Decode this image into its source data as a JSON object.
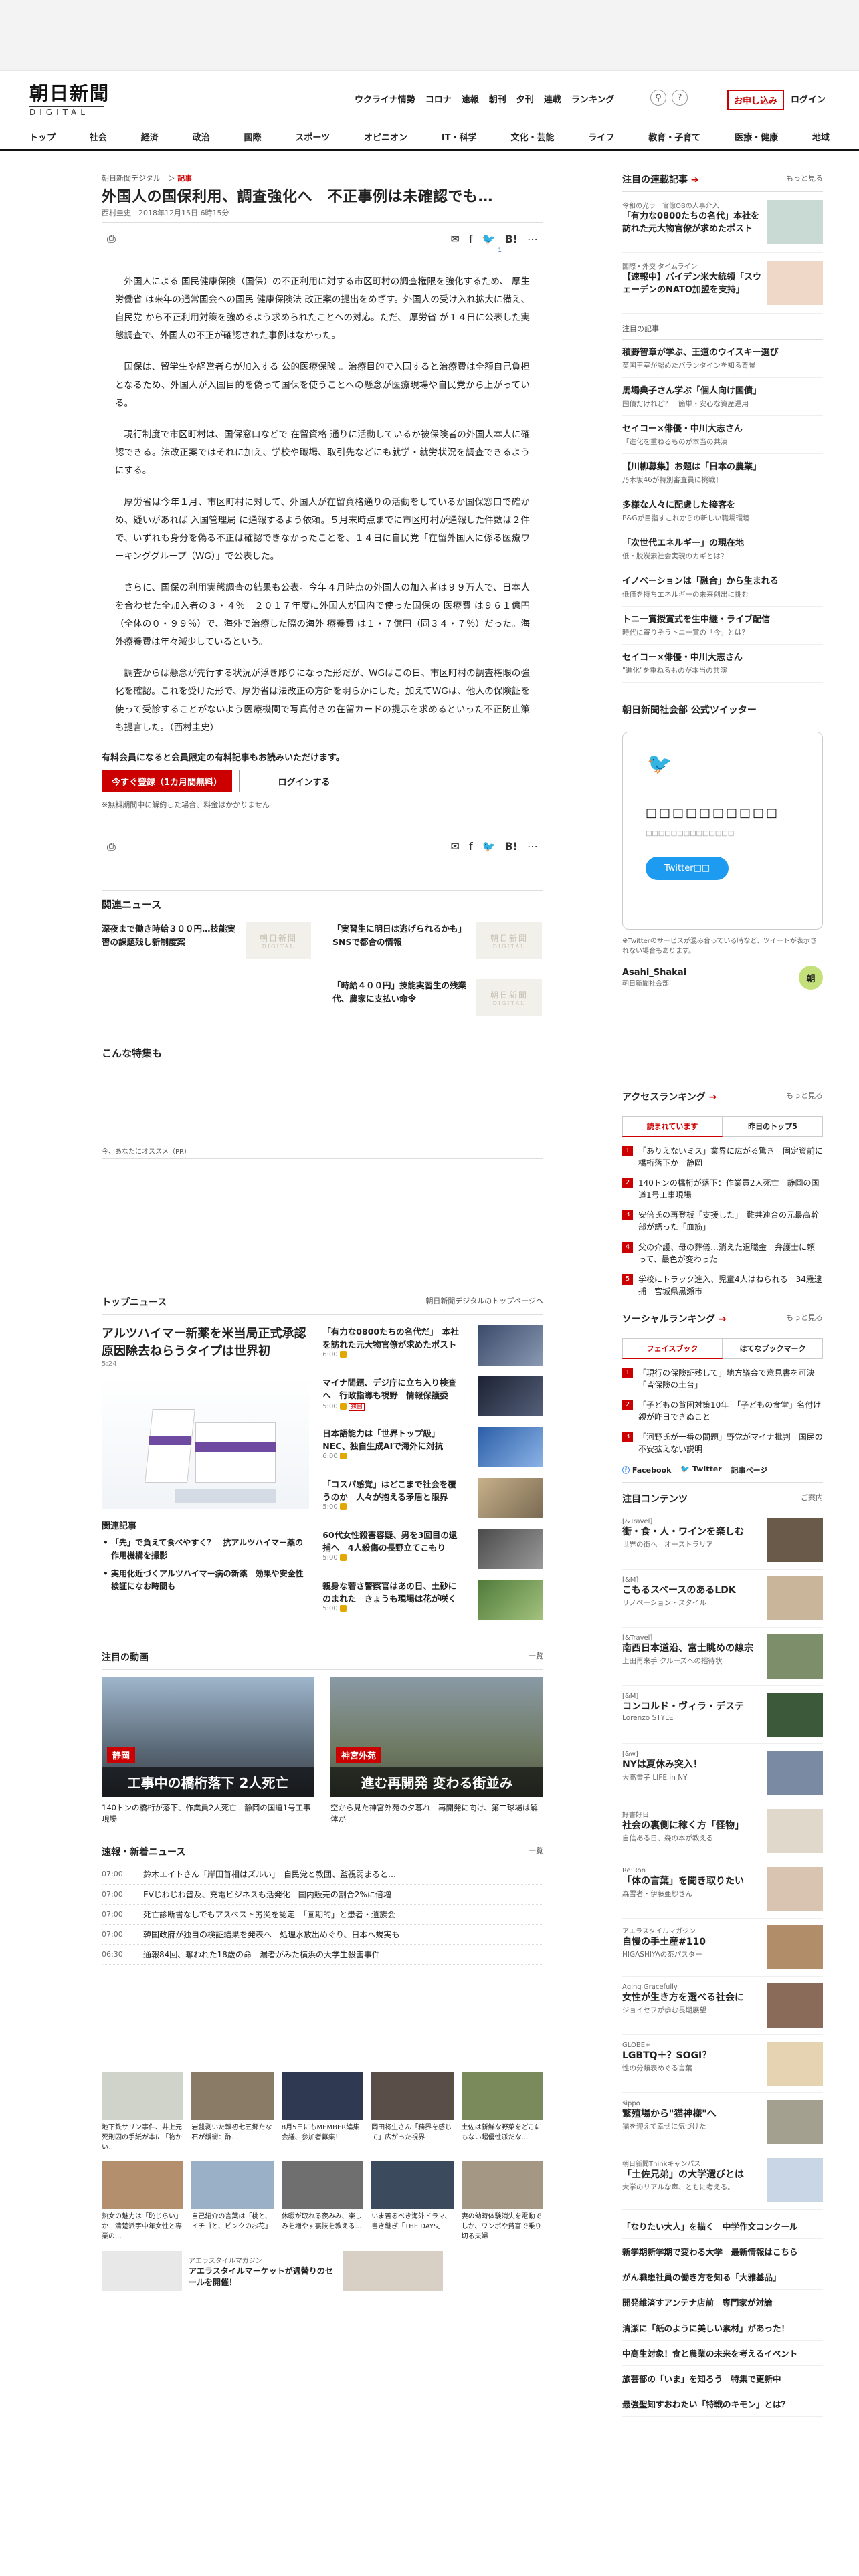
{
  "header": {
    "logo_main": "朝日新聞",
    "logo_sub": "DIGITAL",
    "nav": [
      "ウクライナ情勢",
      "コロナ",
      "速報",
      "朝刊",
      "夕刊",
      "連載",
      "ランキング"
    ],
    "apply_label": "お申し込み",
    "login_label": "ログイン"
  },
  "category_nav": [
    "トップ",
    "社会",
    "経済",
    "政治",
    "国際",
    "スポーツ",
    "オピニオン",
    "IT・科学",
    "文化・芸能",
    "ライフ",
    "教育・子育て",
    "医療・健康",
    "地域"
  ],
  "breadcrumb": {
    "site": "朝日新聞デジタル",
    "section": "記事"
  },
  "article": {
    "title": "外国人の国保利用、調査強化へ　不正事例は未確認でも…",
    "byline": "西村圭史　2018年12月15日 6時15分",
    "share_count": "1",
    "share_link": "list",
    "paragraphs": [
      "外国人による 国民健康保険（国保）の不正利用に対する市区町村の調査権限を強化するため、 厚生労働省 は来年の通常国会への国民 健康保険法 改正案の提出をめざす。外国人の受け入れ拡大に備え、 自民党 から不正利用対策を強めるよう求められたことへの対応。ただ、 厚労省 が１４日に公表した実態調査で、外国人の不正が確認された事例はなかった。",
      "国保は、留学生や経営者らが加入する 公的医療保険 。治療目的で入国すると治療費は全額自己負担となるため、外国人が入国目的を偽って国保を使うことへの懸念が医療現場や自民党から上がっている。",
      "現行制度で市区町村は、国保窓口などで 在留資格 通りに活動しているか被保険者の外国人本人に確認できる。法改正案ではそれに加え、学校や職場、取引先などにも就学・就労状況を調査できるようにする。",
      "厚労省は今年１月、市区町村に対して、外国人が在留資格通りの活動をしているか国保窓口で確かめ、疑いがあれば 入国管理局 に通報するよう依頼。５月末時点までに市区町村が通報した件数は２件で、いずれも身分を偽る不正は確認できなかったことを、１４日に自民党「在留外国人に係る医療ワーキンググループ（WG）」で公表した。",
      "さらに、国保の利用実態調査の結果も公表。今年４月時点の外国人の加入者は９９万人で、日本人を合わせた全加入者の３・４％。２０１７年度に外国人が国内で使った国保の 医療費 は９６１億円（全体の０・９９％）で、海外で治療した際の海外 療養費 は１・７億円（同３４・７％）だった。海外療養費は年々減少しているという。",
      "調査からは懸念が先行する状況が浮き彫りになった形だが、WGはこの日、市区町村の調査権限の強化を確認。これを受けた形で、厚労省は法改正の方針を明らかにした。加えてWGは、他人の保険証を使って受診することがないよう医療機関で写真付きの在留カードの提示を求めるといった不正防止策も提言した。（西村圭史）"
    ],
    "member_title": "有料会員になると会員限定の有料記事もお読みいただけます。",
    "register_label": "今すぐ登録（1カ月間無料）",
    "login_label": "ログインする",
    "member_note": "※無料期間中に解約した場合、料金はかかりません"
  },
  "related": {
    "heading": "関連ニュース",
    "items": [
      "深夜まで働き時給３００円…技能実習の課題残し新制度案",
      "「実習生に明日は逃げられるかも」　SNSで都合の情報",
      "「時給４００円」技能実習生の残業代、農家に支払い命令"
    ]
  },
  "special": {
    "heading": "こんな特集も"
  },
  "pr_label": "今、あなたにオススメ（PR）",
  "top_news": {
    "heading": "トップニュース",
    "more": "朝日新聞デジタルのトップページへ",
    "lead_title": "アルツハイマー新薬を米当局正式承認　原因除去ねらうタイプは世界初",
    "lead_time": "5:24",
    "items": [
      {
        "title": "「有力な0800たちの名代だ」　本社を訪れた元大物官僚が求めたポスト",
        "time": "6:00"
      },
      {
        "title": "マイナ問題、デジ庁に立ち入り検査へ　行政指導も視野　情報保護委",
        "time": "5:00",
        "tag": "独自"
      },
      {
        "title": "日本語能力は「世界トップ級」　NEC、独自生成AIで海外に対抗",
        "time": "6:00"
      },
      {
        "title": "「コスパ感覚」はどこまで社会を覆うのか　人々が抱える矛盾と限界",
        "time": "5:00"
      },
      {
        "title": "60代女性殺害容疑、男を3回目の逮捕へ　4人殺傷の長野立てこもり",
        "time": "5:00"
      },
      {
        "title": "親身な若さ警察官はあの日、土砂に のまれた　きょうも現場は花が咲く",
        "time": "5:00"
      }
    ],
    "related_heading": "関連記事",
    "related": [
      "「先」で負えて食べやすく？　抗アルツハイマー薬の作用機構を撮影",
      "実用化近づくアルツハイマー病の新薬　効果や安全性検証になお時間も"
    ]
  },
  "videos": {
    "heading": "注目の動画",
    "more": "一覧",
    "items": [
      {
        "tag": "静岡",
        "overlay": "工事中の橋桁落下 2人死亡",
        "caption": "140トンの橋桁が落下、作業員2人死亡　静岡の国道1号工事現場"
      },
      {
        "tag": "神宮外苑",
        "overlay": "進む再開発 変わる街並み",
        "caption": "空から見た神宮外苑の夕暮れ　再開発に向け、第二球場は解体が"
      }
    ]
  },
  "breaking": {
    "heading": "速報・新着ニュース",
    "more": "一覧",
    "items": [
      {
        "time": "07:00",
        "text": "鈴木エイトさん「岸田首相はズルい」　自民党と教団、監視弱まると…"
      },
      {
        "time": "07:00",
        "text": "EVじわじわ普及、充電ビジネスも活発化　国内販売の割合2%に倍増"
      },
      {
        "time": "07:00",
        "text": "死亡診断書なしでもアスベスト労災を認定　「画期的」と患者・遺族会"
      },
      {
        "time": "07:00",
        "text": "韓国政府が独自の検証結果を発表へ　処理水放出めぐり、日本へ規実も"
      },
      {
        "time": "06:30",
        "text": "通報84回、奪われた18歳の命　漏者がみた横浜の大学生殺害事件"
      }
    ]
  },
  "bottom_grid": [
    "地下鉄サリン事件、井上元死刑囚の手紙が本に「物かい…",
    "岩盤剥いた報初七五郷たな石が緩衝：酢…",
    "8月5日にもMEMBER編集会議、参加者募集！",
    "岡田将生さん「務界を感じて」広がった視界",
    "土佐は新鮮な野菜をどこにもない超優性派だな…",
    "熟女の魅力は「恥じらい」か　清楚派宇中年女性と専業の…",
    "自己紹介の言葉は「桃と、イチゴと、ピンクのお花」",
    "休暇が取れる夜みみ、楽しみを増やす裏技を教える…",
    "いま苦るべき海外ドラマ、書き継ぎ「THE DAYS」",
    "妻の幼時体験消失を電動でしか、ワンボや貧富で乗り切る夫婦"
  ],
  "ad": {
    "label": "アエラスタイルマガジン",
    "text": "アエラスタイルマーケットが週替りのセールを開催！"
  },
  "sidebar": {
    "series_heading": "注目の連載記事",
    "more": "もっと見る",
    "series": [
      {
        "meta": "令和の光ラ　官僚OBの人事介入",
        "title": "「有力な0800たちの名代」本社を訪れた元大物官僚が求めたポスト"
      },
      {
        "meta": "国際・外交 タイムライン",
        "title": "【速報中】バイデン米大統領「スウェーデンのNATO加盟を支持」"
      }
    ],
    "paid_label": "注目の記事",
    "paid": [
      {
        "title": "積野智章が学ぶ、王道のウイスキー選び",
        "sub": "英国王室が認めたバランタインを知る背景"
      },
      {
        "title": "馬場典子さん学ぶ「個人向け国債」",
        "sub": "国債だけれど？　簡単・安心な資産運用"
      },
      {
        "title": "セイコー×俳優・中川大志さん",
        "sub": "「進化を重ねるものが本当の共演"
      },
      {
        "title": "【川柳募集】お題は「日本の農業」",
        "sub": "乃木坂46が特別審査員に挑戦！"
      },
      {
        "title": "多様な人々に配慮した接客を",
        "sub": "P&Gが目指すこれからの新しい職場環境"
      },
      {
        "title": "「次世代エネルギー」の現在地",
        "sub": "低・脱炭素社会実現のカギとは？"
      },
      {
        "title": "イノベーションは「融合」から生まれる",
        "sub": "低価を持ちエネルギーの未来創出に挑む"
      },
      {
        "title": "トニー賞授賞式を生中継・ライブ配信",
        "sub": "時代に寄りそうトニー賞の「今」とは？"
      },
      {
        "title": "セイコー×俳優・中川大志さん",
        "sub": "\"進化\"を重ねるものが本当の共演"
      }
    ],
    "twitter_heading": "朝日新聞社会部 公式ツイッター",
    "twitter_box_title": "□□□□□□□□□□",
    "twitter_box_sub": "□□□□□□□□□□□□□□",
    "twitter_btn": "Twitter□□",
    "twitter_note": "※Twitterのサービスが混み合っている時など、ツイートが表示されない場合もあります。",
    "twitter_account": "Asahi_Shakai",
    "twitter_account_sub": "朝日新聞社会部",
    "ranking_heading": "アクセスランキング",
    "ranking_tabs": [
      "読まれています",
      "昨日のトップ5"
    ],
    "ranking": [
      "「ありえないミス」業界に広がる驚き　固定資前に橋桁落下か　静岡",
      "140トンの橋桁が落下：作業員2人死亡　静岡の国道1号工事現場",
      "安倍氏の再登板「支援した」　難共連合の元最高幹部が語った「血筋」",
      "父の介護、母の葬儀…消えた退職金　弁護士に頼って、最色が変わった",
      "学校にトラック進入、児童4人はねられる　34歳逮捕　宮城県黒瀬市"
    ],
    "social_heading": "ソーシャルランキング",
    "social_tabs": [
      "フェイスブック",
      "はてなブックマーク"
    ],
    "social": [
      "「現行の保険証残して」地方議会で意見書を可決　「皆保険の土台」",
      "「子どもの貧困対策10年　「子どもの食堂」名付け親が昨日できぬこと",
      "「河野氏が一番の問題」野党がマイナ批判　国民の不安拡えない説明"
    ],
    "follow": [
      "Facebook",
      "Twitter",
      "記事ページ"
    ],
    "attn_heading": "注目コンテンツ",
    "attn_more": "ご案内",
    "attn": [
      {
        "meta": "[&Travel]",
        "title": "街・食・人・ワインを楽しむ",
        "sub": "世界の街へ　オーストラリア"
      },
      {
        "meta": "[&M]",
        "title": "こもるスペースのあるLDK",
        "sub": "リノベーション・スタイル"
      },
      {
        "meta": "[&Travel]",
        "title": "南西日本道沿、富士眺めの線宗",
        "sub": "上田再来手 クルーズへの招待状"
      },
      {
        "meta": "[&M]",
        "title": "コンコルド・ヴィラ・デステ",
        "sub": "Lorenzo STYLE"
      },
      {
        "meta": "[&w]",
        "title": "NYは夏休み突入！",
        "sub": "大高書子 LIFE in NY"
      },
      {
        "meta": "好書好日",
        "title": "社会の裏側に稼く方「怪物」",
        "sub": "自信ある日、森の本が教える"
      },
      {
        "meta": "Re:Ron",
        "title": "「体の言葉」を聞き取りたい",
        "sub": "森雪者・伊藤亜紗さん"
      },
      {
        "meta": "アエラスタイルマガジン",
        "title": "自慢の手土産#110",
        "sub": "HIGASHIYAの茶パスター"
      },
      {
        "meta": "Aging Gracefully",
        "title": "女性が生き方を選べる社会に",
        "sub": "ジョイセフが歩む長期展望"
      },
      {
        "meta": "GLOBE+",
        "title": "LGBTQ＋？SOGI？",
        "sub": "性の分類表めぐる言葉"
      },
      {
        "meta": "sippo",
        "title": "繁殖場から\"猫神様\"へ",
        "sub": "猫を迎えて幸せに気づけた"
      }
    ],
    "foot_meta": "朝日新聞Thinkキャンパス",
    "foot_title": "「土佐兄弟」の大学選びとは",
    "foot_sub": "大学のリアルな声、ともに考える。",
    "bottom_links": [
      "「なりたい大人」を描く　中学作文コンクール",
      "新学期新学期で変わる大学　最新情報はこちら",
      "がん職患社員の働き方を知る「大雅基品」",
      "開発維済すアンテナ店前　専門家が対論",
      "清潔に「紙のように美しい素材」があった！",
      "中高生対象！食と農業の未来を考えるイベント",
      "旅芸部の「いま」を知ろう　特集で更新中",
      "最強聖知すおわたい「特戦のキモン」とは？"
    ]
  }
}
